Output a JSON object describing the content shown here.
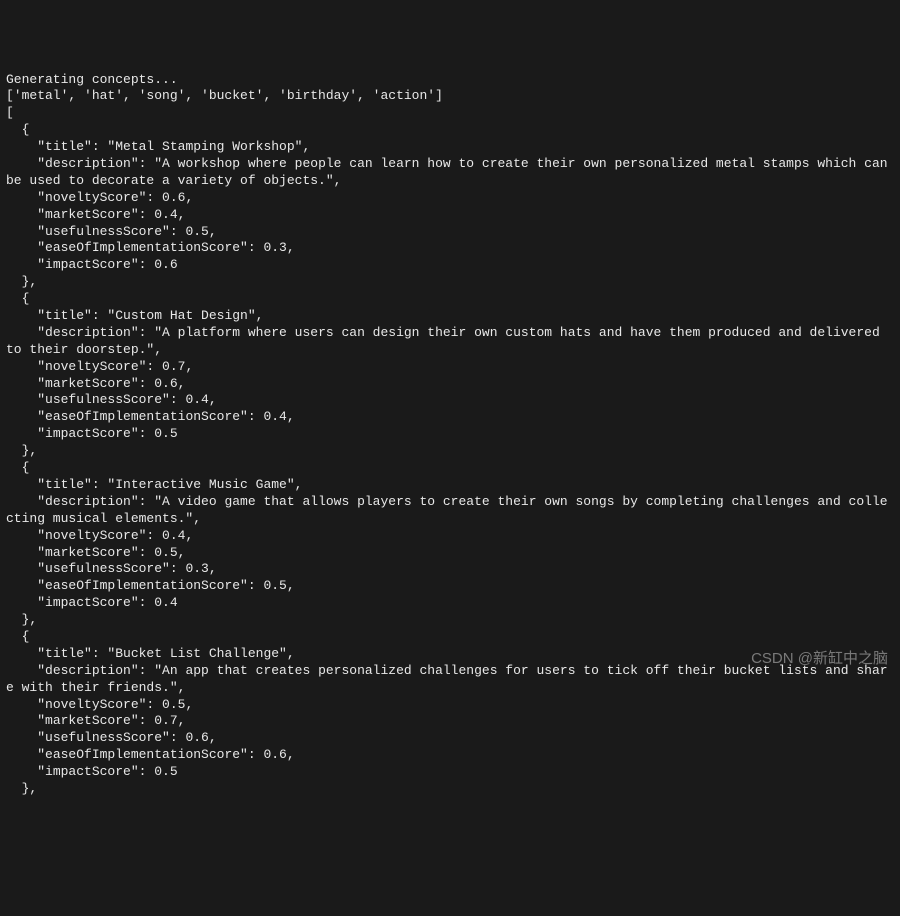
{
  "header_line": "Generating concepts...",
  "concepts_array": "['metal', 'hat', 'song', 'bucket', 'birthday', 'action']",
  "entries": [
    {
      "title": "Metal Stamping Workshop",
      "description": "A workshop where people can learn how to create their own personalized metal stamps which can be used to decorate a variety of objects.",
      "noveltyScore": 0.6,
      "marketScore": 0.4,
      "usefulnessScore": 0.5,
      "easeOfImplementationScore": 0.3,
      "impactScore": 0.6
    },
    {
      "title": "Custom Hat Design",
      "description": "A platform where users can design their own custom hats and have them produced and delivered to their doorstep.",
      "noveltyScore": 0.7,
      "marketScore": 0.6,
      "usefulnessScore": 0.4,
      "easeOfImplementationScore": 0.4,
      "impactScore": 0.5
    },
    {
      "title": "Interactive Music Game",
      "description": "A video game that allows players to create their own songs by completing challenges and collecting musical elements.",
      "noveltyScore": 0.4,
      "marketScore": 0.5,
      "usefulnessScore": 0.3,
      "easeOfImplementationScore": 0.5,
      "impactScore": 0.4
    },
    {
      "title": "Bucket List Challenge",
      "description": "An app that creates personalized challenges for users to tick off their bucket lists and share with their friends.",
      "noveltyScore": 0.5,
      "marketScore": 0.7,
      "usefulnessScore": 0.6,
      "easeOfImplementationScore": 0.6,
      "impactScore": 0.5
    }
  ],
  "watermark": "CSDN @新缸中之脑"
}
